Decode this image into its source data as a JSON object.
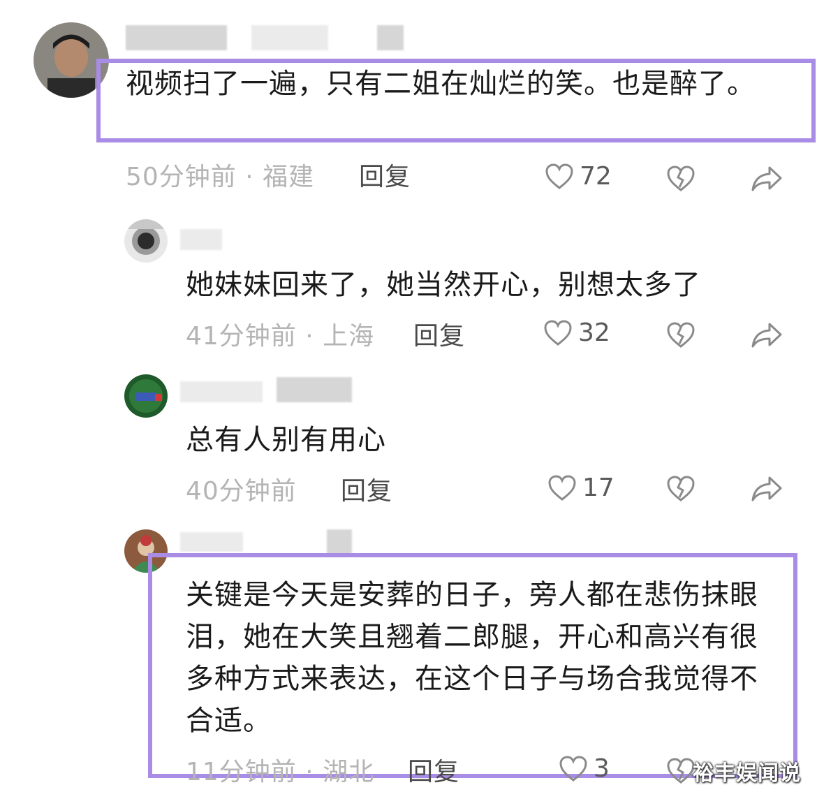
{
  "comments": [
    {
      "text": "视频扫了一遍，只有二姐在灿烂的笑。也是醉了。",
      "meta": "50分钟前 · 福建",
      "reply_label": "回复",
      "likes": "72"
    },
    {
      "text": "她妹妹回来了，她当然开心，别想太多了",
      "meta": "41分钟前 · 上海",
      "reply_label": "回复",
      "likes": "32"
    },
    {
      "text": "总有人别有用心",
      "meta": "40分钟前",
      "reply_label": "回复",
      "likes": "17"
    },
    {
      "text": "关键是今天是安葬的日子，旁人都在悲伤抹眼泪，她在大笑且翘着二郎腿，开心和高兴有很多种方式来表达，在这个日子与场合我觉得不合适。",
      "meta": "11分钟前 · 湖北",
      "reply_label": "回复",
      "likes": "3"
    }
  ],
  "watermark": "裕丰娱闻说",
  "icons": {
    "like": "heart-outline-icon",
    "dislike": "broken-heart-icon",
    "share": "share-arrow-icon"
  },
  "colors": {
    "highlight": "#a88ce6",
    "meta_gray": "#b4b4b4",
    "icon_gray": "#8a8a8a"
  }
}
